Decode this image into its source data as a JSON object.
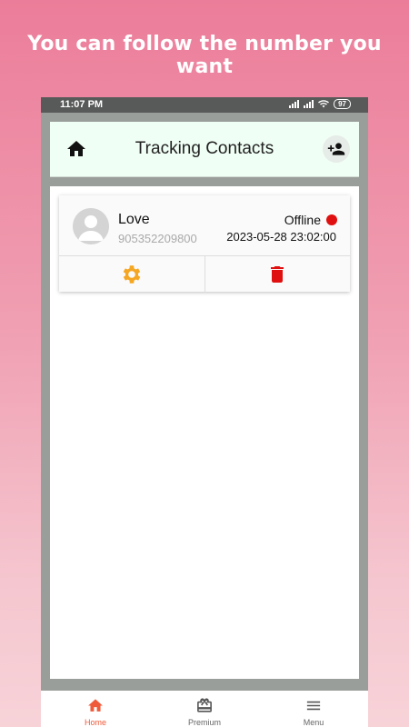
{
  "headline": "You can follow the number you want",
  "status_bar": {
    "time": "11:07 PM",
    "battery": "97"
  },
  "app_bar": {
    "title": "Tracking Contacts"
  },
  "contacts": [
    {
      "name": "Love",
      "phone": "905352209800",
      "status": "Offline",
      "last_seen": "2023-05-28 23:02:00"
    }
  ],
  "colors": {
    "status_offline": "#e01010",
    "settings_icon": "#f5a623",
    "delete_icon": "#e01010",
    "active_tab": "#ee5a3a"
  },
  "icons": {
    "home": "home-icon",
    "add_user": "person-add-icon",
    "settings": "gear-icon",
    "delete": "trash-icon",
    "premium": "gift-card-icon",
    "menu": "hamburger-icon"
  },
  "bottom_nav": [
    {
      "label": "Home",
      "active": true
    },
    {
      "label": "Premium",
      "active": false
    },
    {
      "label": "Menu",
      "active": false
    }
  ]
}
